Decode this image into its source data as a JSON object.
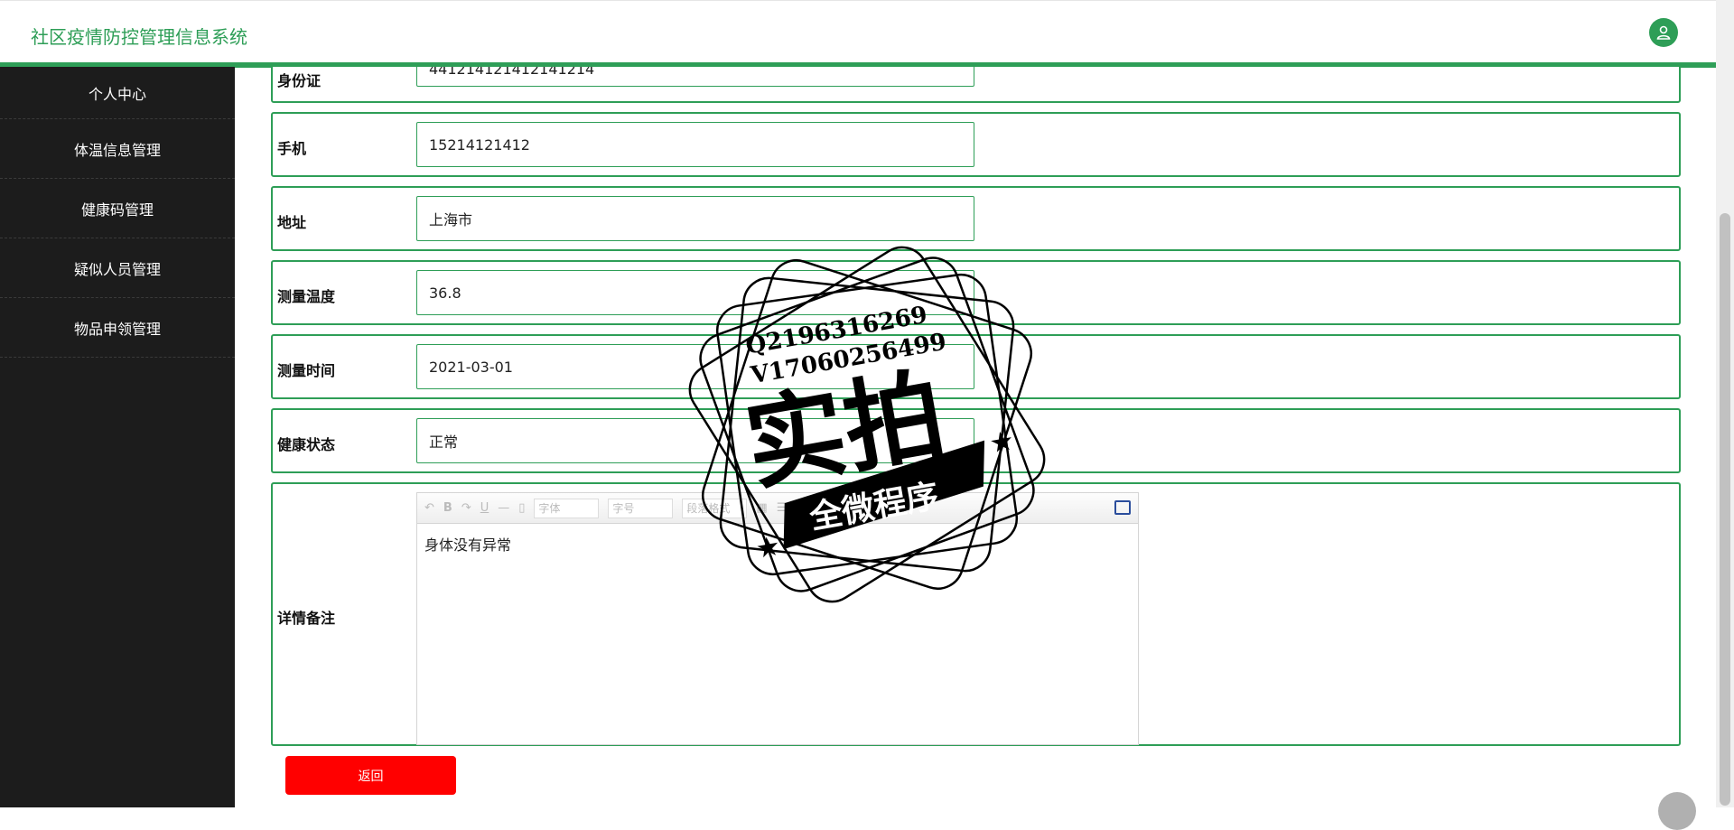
{
  "header": {
    "title": "社区疫情防控管理信息系统"
  },
  "sidebar": {
    "items": [
      {
        "label": "个人中心"
      },
      {
        "label": "体温信息管理"
      },
      {
        "label": "健康码管理"
      },
      {
        "label": "疑似人员管理"
      },
      {
        "label": "物品申领管理"
      }
    ]
  },
  "form": {
    "id_card": {
      "label": "身份证",
      "value": "441214121412141214"
    },
    "phone": {
      "label": "手机",
      "value": "15214121412"
    },
    "address": {
      "label": "地址",
      "value": "上海市"
    },
    "temperature": {
      "label": "测量温度",
      "value": "36.8"
    },
    "measure_time": {
      "label": "测量时间",
      "value": "2021-03-01"
    },
    "health_status": {
      "label": "健康状态",
      "value": "正常"
    },
    "details": {
      "label": "详情备注",
      "value": "身体没有异常",
      "toolbar": {
        "font_select": "字体",
        "size_select": "字号",
        "format_select": "段落格式"
      }
    }
  },
  "buttons": {
    "back": "返回"
  },
  "watermark": {
    "line1": "Q2196316269",
    "line2": "V17060256499",
    "big": "实拍",
    "banner": "全微程序"
  }
}
